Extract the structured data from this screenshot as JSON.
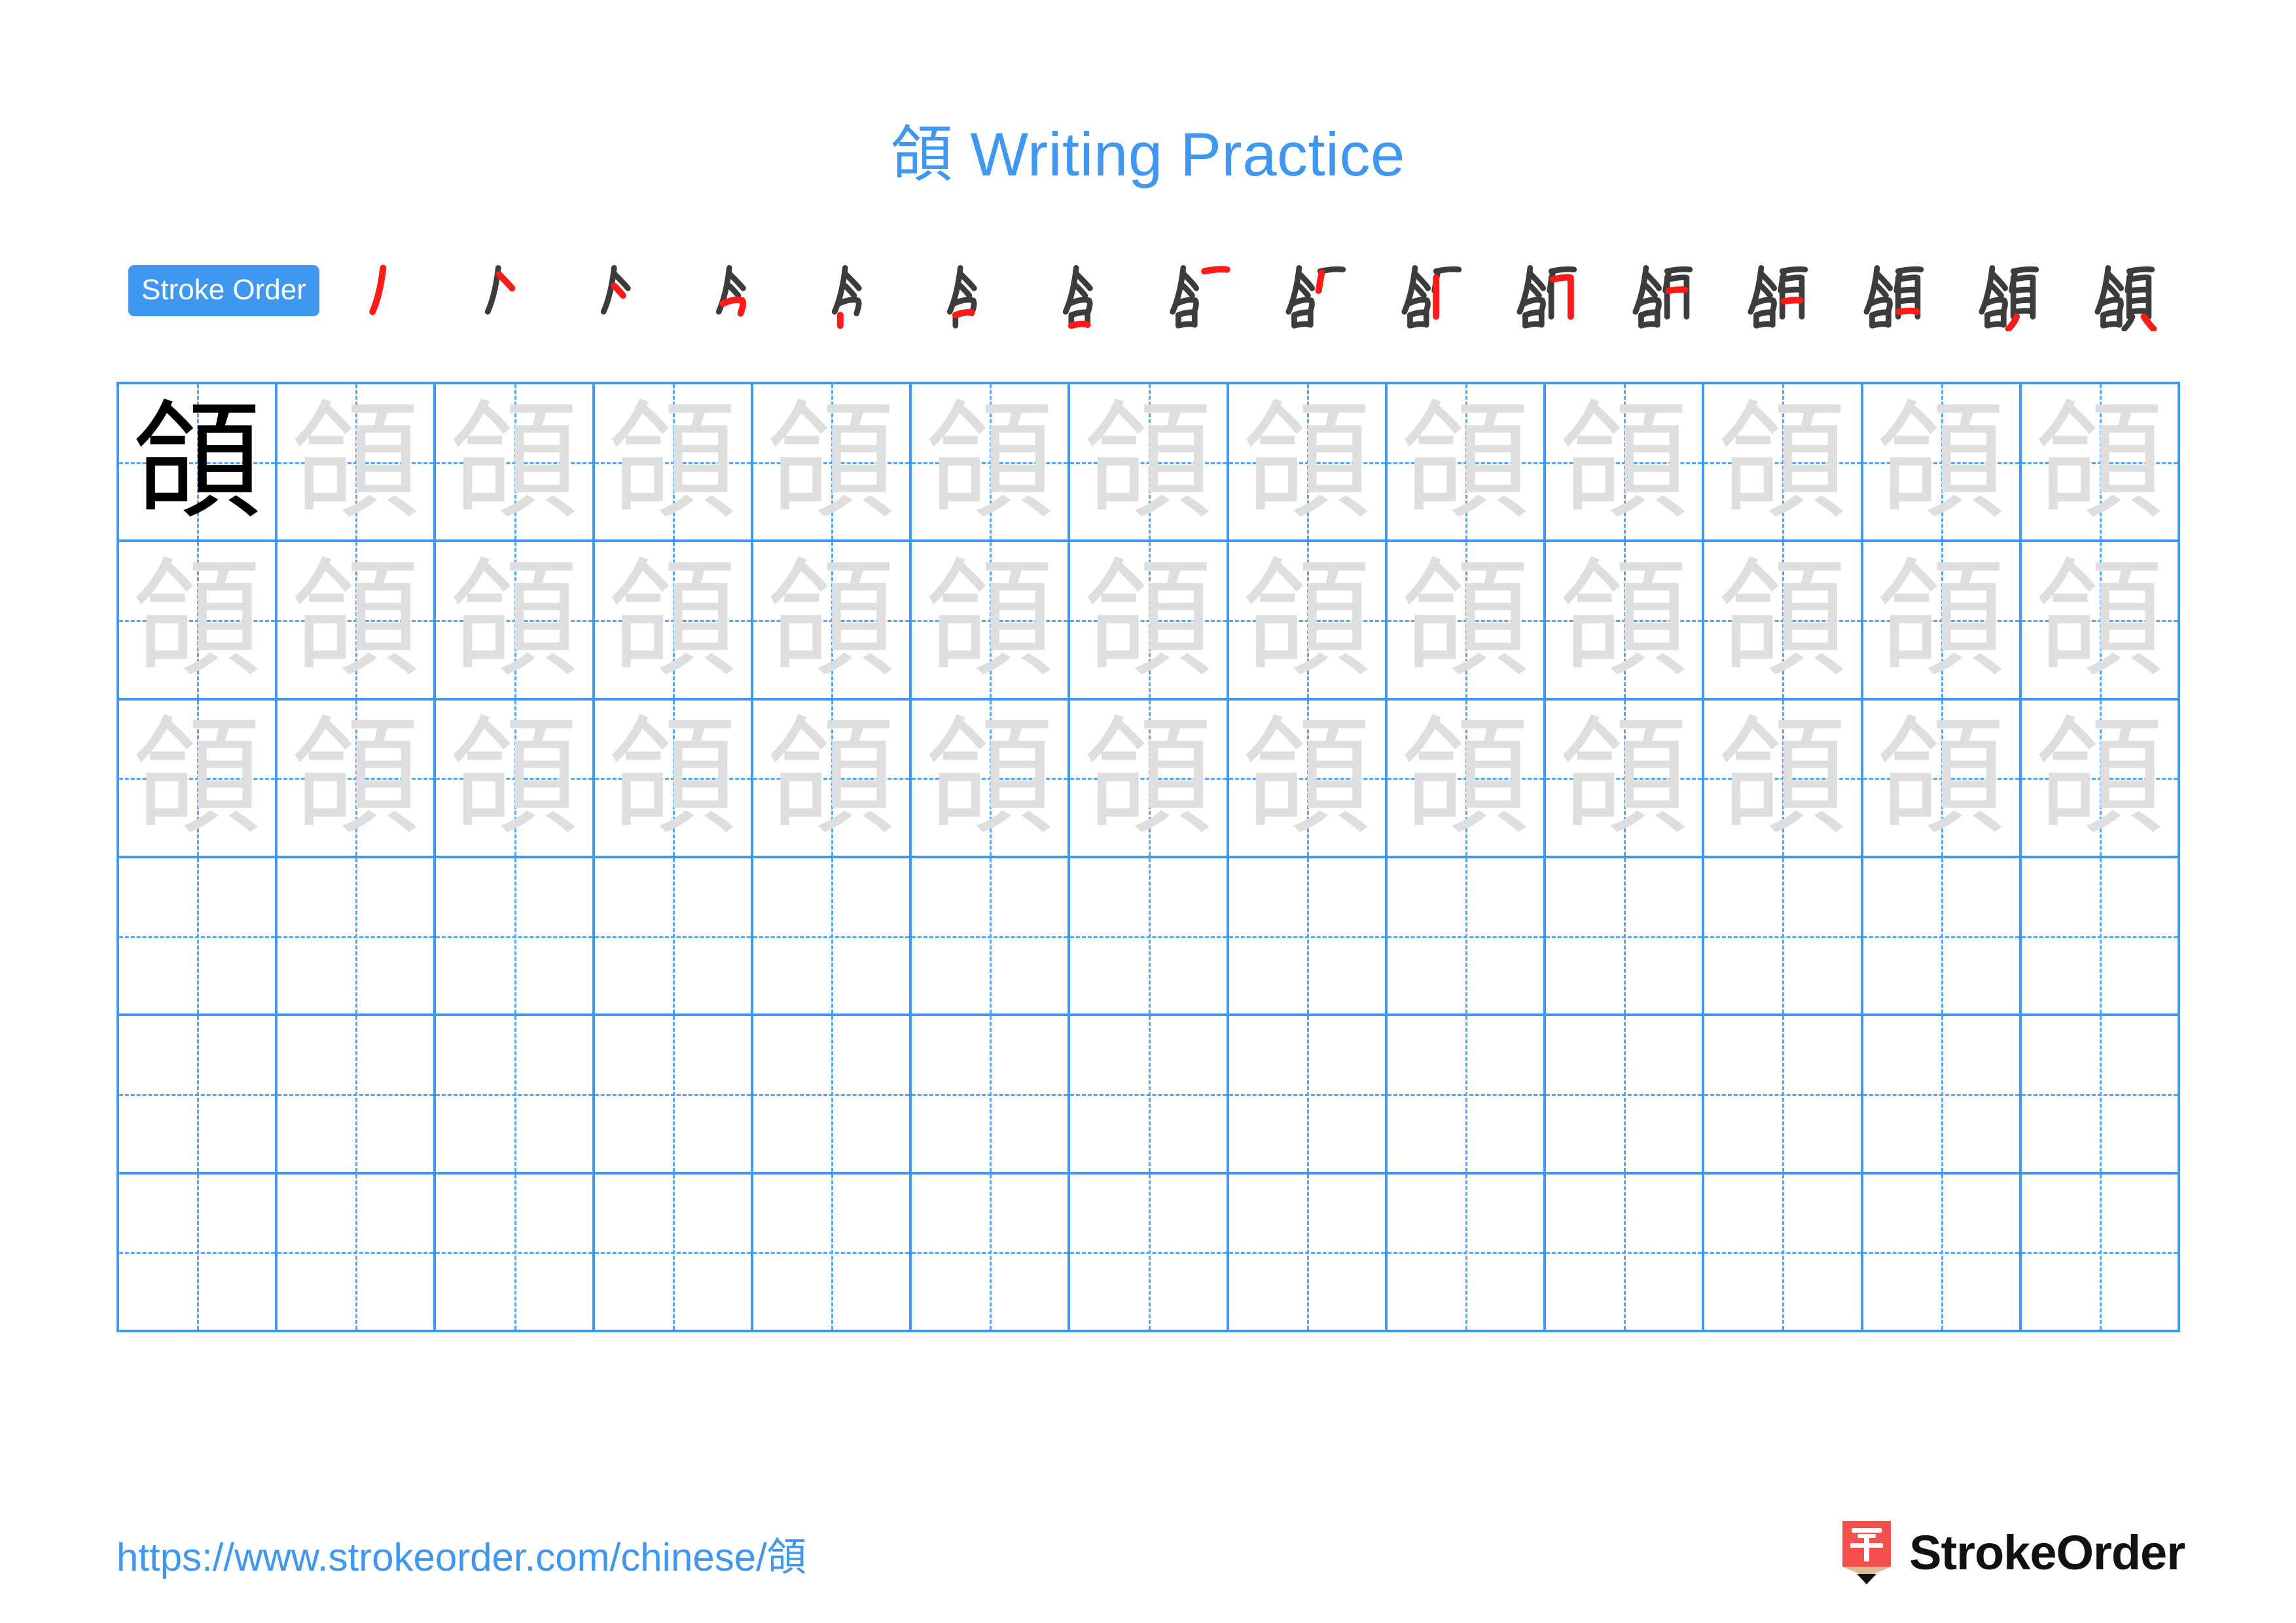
{
  "character": "頜",
  "header": {
    "title": "頜 Writing Practice"
  },
  "stroke_order": {
    "badge_label": "Stroke Order",
    "total_strokes": 16,
    "new_stroke_color": "#ff1a1a",
    "existing_stroke_color": "#3c3c3c",
    "steps": [
      {
        "index": 1,
        "partial": "丿"
      },
      {
        "index": 2,
        "partial": "亽"
      },
      {
        "index": 3,
        "partial": "亽"
      },
      {
        "index": 4,
        "partial": "今"
      },
      {
        "index": 5,
        "partial": "今"
      },
      {
        "index": 6,
        "partial": "含"
      },
      {
        "index": 7,
        "partial": "含"
      },
      {
        "index": 8,
        "partial": "含"
      },
      {
        "index": 9,
        "partial": "含"
      },
      {
        "index": 10,
        "partial": "頜"
      },
      {
        "index": 11,
        "partial": "頜"
      },
      {
        "index": 12,
        "partial": "頜"
      },
      {
        "index": 13,
        "partial": "頜"
      },
      {
        "index": 14,
        "partial": "頜"
      },
      {
        "index": 15,
        "partial": "頜"
      },
      {
        "index": 16,
        "partial": "頜"
      }
    ]
  },
  "grid": {
    "columns": 13,
    "rows": 6,
    "line_color": "#3f97ef",
    "guide_color": "#56a5f2",
    "model_glyph_color": "#3c3c3c",
    "trace_glyph_color": "#dedede",
    "cells": [
      [
        "model",
        "trace",
        "trace",
        "trace",
        "trace",
        "trace",
        "trace",
        "trace",
        "trace",
        "trace",
        "trace",
        "trace",
        "trace"
      ],
      [
        "trace",
        "trace",
        "trace",
        "trace",
        "trace",
        "trace",
        "trace",
        "trace",
        "trace",
        "trace",
        "trace",
        "trace",
        "trace"
      ],
      [
        "trace",
        "trace",
        "trace",
        "trace",
        "trace",
        "trace",
        "trace",
        "trace",
        "trace",
        "trace",
        "trace",
        "trace",
        "trace"
      ],
      [
        "empty",
        "empty",
        "empty",
        "empty",
        "empty",
        "empty",
        "empty",
        "empty",
        "empty",
        "empty",
        "empty",
        "empty",
        "empty"
      ],
      [
        "empty",
        "empty",
        "empty",
        "empty",
        "empty",
        "empty",
        "empty",
        "empty",
        "empty",
        "empty",
        "empty",
        "empty",
        "empty"
      ],
      [
        "empty",
        "empty",
        "empty",
        "empty",
        "empty",
        "empty",
        "empty",
        "empty",
        "empty",
        "empty",
        "empty",
        "empty",
        "empty"
      ]
    ]
  },
  "footer": {
    "url": "https://www.strokeorder.com/chinese/頜",
    "brand_name": "StrokeOrder",
    "logo_character": "字",
    "logo_body_color": "#f4514e",
    "logo_wood_color": "#e0bb94",
    "logo_tip_color": "#111111"
  },
  "colors": {
    "accent_blue": "#3f97ef",
    "page_background": "#ffffff"
  }
}
